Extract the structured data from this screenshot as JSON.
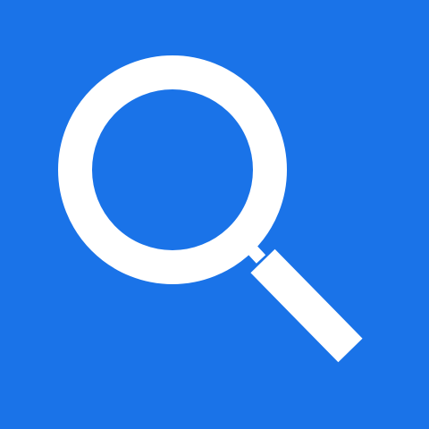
{
  "app_icon": {
    "icon": "search-icon",
    "background_color": "#1A73E8",
    "glyph_color": "#FFFFFF"
  }
}
